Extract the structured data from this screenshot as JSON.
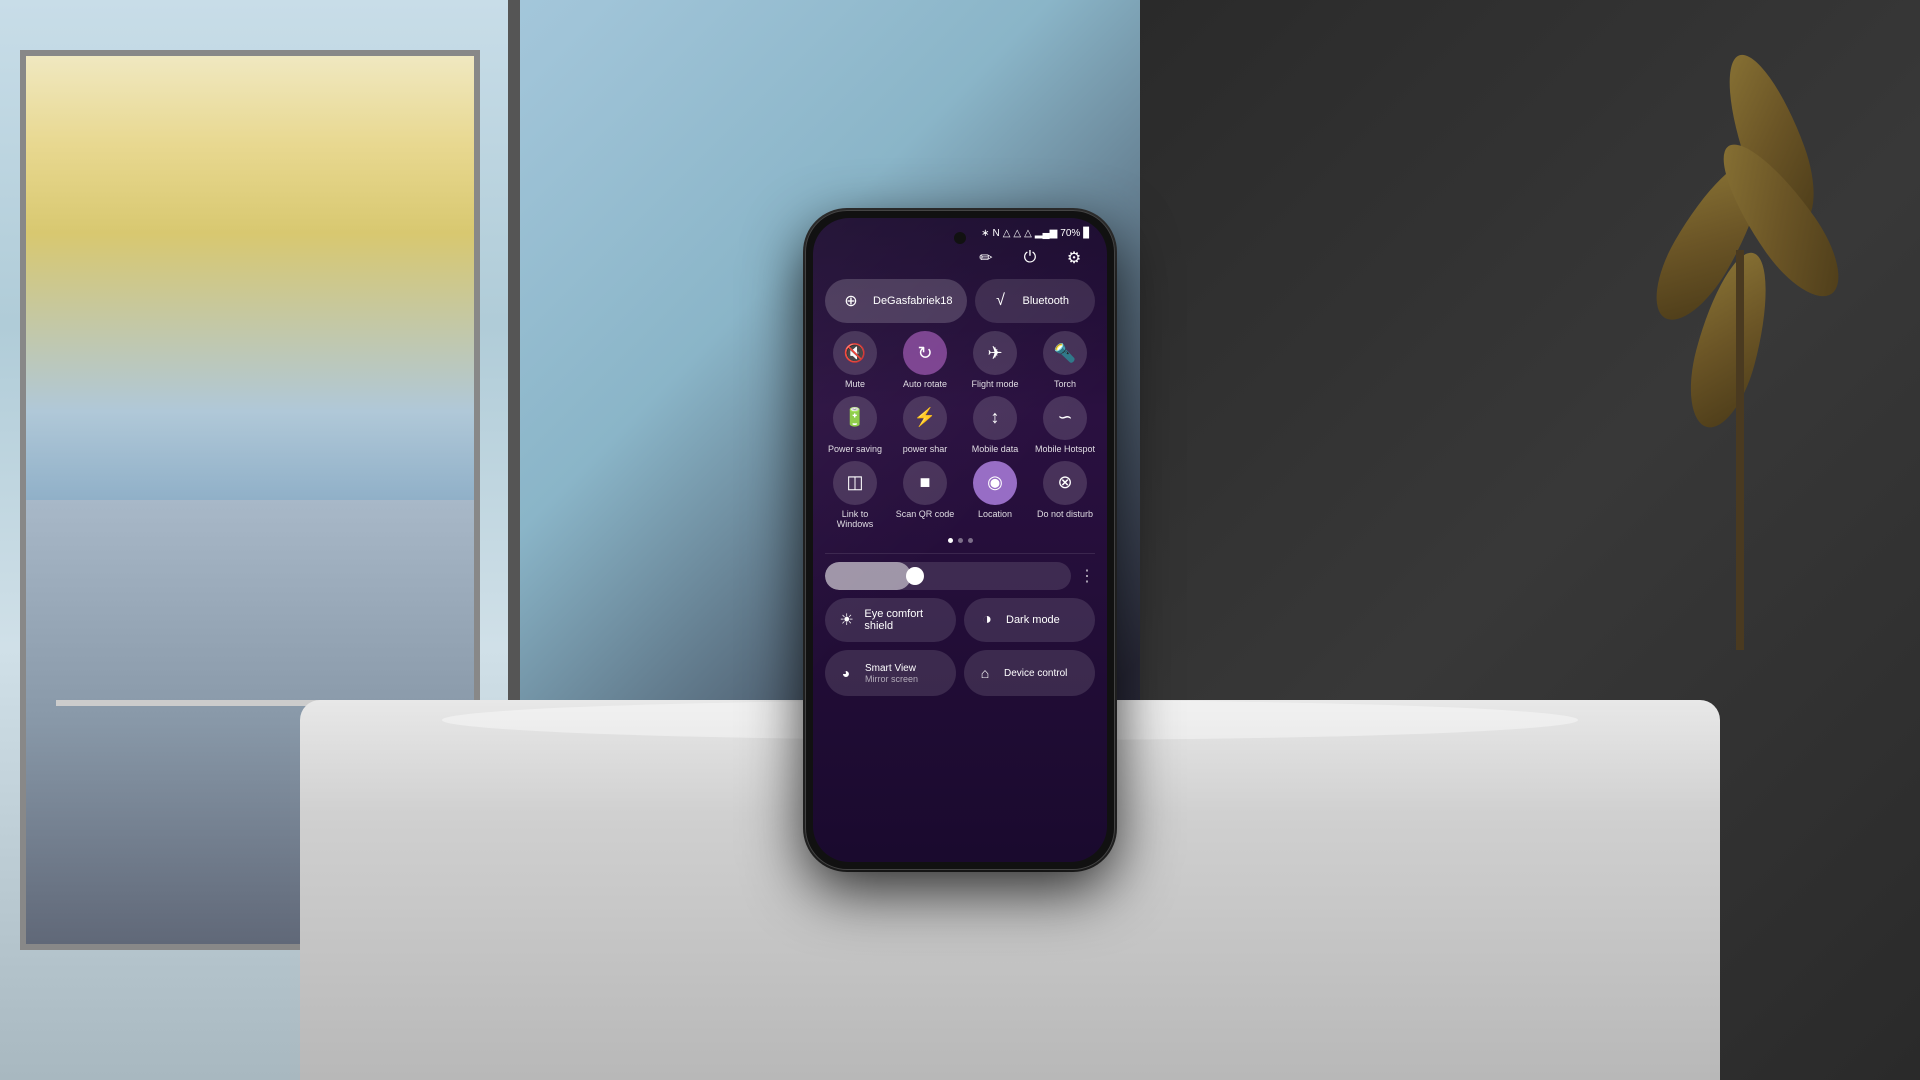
{
  "scene": {
    "background": "outdoor-room"
  },
  "phone": {
    "status_bar": {
      "bluetooth_icon": "bluetooth",
      "nfc_icon": "nfc",
      "silent_icon": "silent",
      "signal_icon": "signal",
      "wifi_icon": "wifi",
      "battery_percent": "70%",
      "battery_icon": "battery"
    },
    "header": {
      "edit_icon": "✏",
      "power_icon": "⏻",
      "settings_icon": "⚙"
    },
    "network_tiles": [
      {
        "icon": "wifi",
        "label": "DeGasfabriek18",
        "active": true
      },
      {
        "icon": "bluetooth",
        "label": "Bluetooth",
        "active": false
      }
    ],
    "quick_tiles": [
      {
        "icon": "🔇",
        "label": "Mute",
        "active": false
      },
      {
        "icon": "↻",
        "label": "Auto rotate",
        "active": true
      },
      {
        "icon": "✈",
        "label": "Flight mode",
        "active": false
      },
      {
        "icon": "🔦",
        "label": "Torch",
        "active": false
      },
      {
        "icon": "🔋",
        "label": "Power saving",
        "active": false
      },
      {
        "icon": "⚡",
        "label": "power shar",
        "active": false
      },
      {
        "icon": "📶",
        "label": "Mobile data",
        "active": false
      },
      {
        "icon": "📡",
        "label": "Mobile Hotspot",
        "active": false
      },
      {
        "icon": "🖥",
        "label": "Link to Windows",
        "active": false
      },
      {
        "icon": "▣",
        "label": "Scan QR code",
        "active": false
      },
      {
        "icon": "📍",
        "label": "Location",
        "active": true
      },
      {
        "icon": "🚫",
        "label": "Do not disturb",
        "active": false
      }
    ],
    "page_dots": [
      {
        "active": true
      },
      {
        "active": false
      },
      {
        "active": false
      }
    ],
    "brightness": {
      "value": 35,
      "more_label": "⋮"
    },
    "comfort_tiles": [
      {
        "icon": "☀",
        "label": "Eye comfort shield"
      },
      {
        "icon": "◑",
        "label": "Dark mode"
      }
    ],
    "bottom_tiles": [
      {
        "icon": "⊕",
        "title": "Smart View",
        "subtitle": "Mirror screen"
      },
      {
        "icon": "⊞",
        "title": "Device control",
        "subtitle": ""
      }
    ]
  }
}
